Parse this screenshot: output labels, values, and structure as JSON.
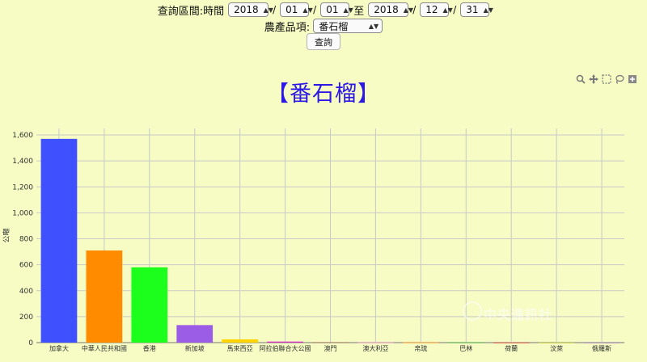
{
  "query": {
    "range_label": "查詢區間:時間",
    "start_year": "2018",
    "start_month": "01",
    "start_day": "01",
    "to_label": "至",
    "end_year": "2018",
    "end_month": "12",
    "end_day": "31",
    "slash": "/",
    "product_label": "農產品項:",
    "product_value": "番石榴",
    "submit_label": "查詢"
  },
  "modebar": [
    "zoom-icon",
    "pan-icon",
    "box-select-icon",
    "lasso-icon",
    "zoom-in-icon"
  ],
  "watermark": "中央通訊社",
  "chart_data": {
    "type": "bar",
    "title": "【番石榴】",
    "xlabel": "",
    "ylabel": "公噸",
    "ylim": [
      0,
      1650
    ],
    "yticks": [
      0,
      200,
      400,
      600,
      800,
      1000,
      1200,
      1400,
      1600
    ],
    "ytick_labels": [
      "0",
      "200",
      "400",
      "600",
      "800",
      "1,000",
      "1,200",
      "1,400",
      "1,600"
    ],
    "grid": true,
    "categories": [
      "加拿大",
      "中華人民共和國",
      "香港",
      "新加坡",
      "馬來西亞",
      "阿拉伯聯合大公國",
      "澳門",
      "澳大利亞",
      "帛琉",
      "巴林",
      "荷蘭",
      "汶萊",
      "俄羅斯"
    ],
    "values": [
      1570,
      710,
      580,
      135,
      25,
      8,
      3,
      2,
      2,
      2,
      1,
      1,
      1
    ],
    "colors": [
      "#3f51ff",
      "#ff8c00",
      "#1cff1c",
      "#9b5de5",
      "#ffd400",
      "#d62dc6",
      "#8c564b",
      "#e377c2",
      "#ff7f0e",
      "#2ca02c",
      "#d62728",
      "#bcbd22",
      "#9467bd"
    ]
  }
}
